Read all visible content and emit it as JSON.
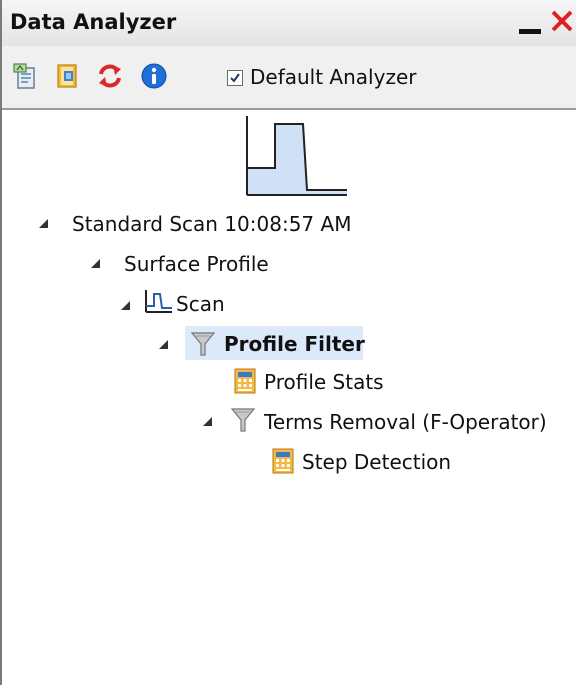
{
  "window": {
    "title": "Data Analyzer",
    "minimize_icon": "minimize-icon",
    "close_icon": "close-icon",
    "close_color": "#e02020"
  },
  "toolbar": {
    "buttons": [
      {
        "icon": "new-analyzer-icon"
      },
      {
        "icon": "open-folder-icon"
      },
      {
        "icon": "refresh-icon"
      },
      {
        "icon": "info-icon"
      }
    ],
    "default_analyzer": {
      "label": "Default Analyzer",
      "checked": true
    }
  },
  "tree": {
    "nodes": [
      {
        "label": "Standard Scan 10:08:57 AM",
        "expanded": true,
        "icon": null
      },
      {
        "label": "Surface Profile",
        "expanded": true,
        "icon": null
      },
      {
        "label": "Scan",
        "expanded": true,
        "icon": "scan-profile-icon"
      },
      {
        "label": "Profile Filter",
        "expanded": true,
        "icon": "filter-icon",
        "selected": true
      },
      {
        "label": "Profile Stats",
        "expanded": null,
        "icon": "calculator-icon"
      },
      {
        "label": "Terms Removal (F-Operator)",
        "expanded": true,
        "icon": "filter-icon"
      },
      {
        "label": "Step Detection",
        "expanded": null,
        "icon": "calculator-icon"
      }
    ]
  },
  "colors": {
    "selection": "#dbe9fb",
    "thumbnail_fill": "#cfe0f7",
    "info_blue": "#1e6fd9",
    "refresh_red": "#d82a2a"
  }
}
